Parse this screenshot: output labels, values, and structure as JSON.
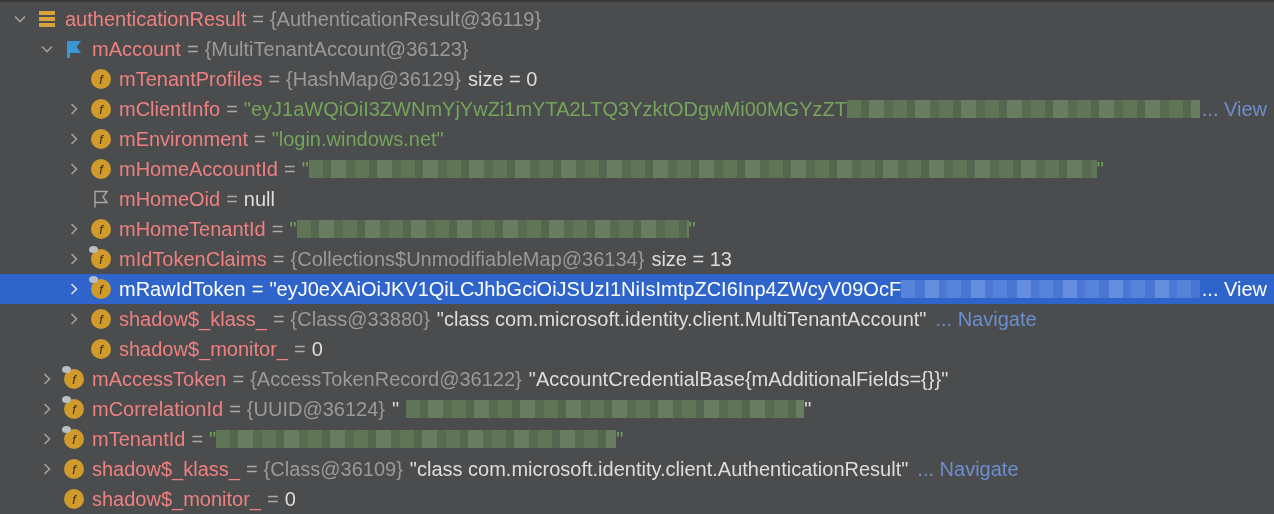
{
  "variables": [
    {
      "name": "authenticationResult",
      "separator": "=",
      "icon": {
        "kind": "object"
      },
      "expanded": true,
      "selected": false,
      "value": [
        {
          "kind": "type",
          "text": "{AuthenticationResult@36119}"
        }
      ],
      "children": [
        {
          "name": "mAccount",
          "separator": "=",
          "icon": {
            "kind": "flag"
          },
          "expanded": true,
          "selected": false,
          "value": [
            {
              "kind": "type",
              "text": "{MultiTenantAccount@36123}"
            }
          ],
          "children": [
            {
              "name": "mTenantProfiles",
              "separator": "=",
              "icon": {
                "kind": "field",
                "letter": "f",
                "overlay": false
              },
              "selected": false,
              "value": [
                {
                  "kind": "type",
                  "text": "{HashMap@36129}"
                },
                {
                  "kind": "plain",
                  "text": "size = 0"
                }
              ]
            },
            {
              "name": "mClientInfo",
              "separator": "=",
              "icon": {
                "kind": "field",
                "letter": "f",
                "overlay": false
              },
              "expanded": false,
              "selected": false,
              "value": [
                {
                  "kind": "string",
                  "text": "\"eyJ1aWQiOiI3ZWNmYjYwZi1mYTA2LTQ3YzktODgwMi00MGYzZT"
                },
                {
                  "kind": "redacted"
                },
                {
                  "kind": "link",
                  "text": "... View"
                }
              ]
            },
            {
              "name": "mEnvironment",
              "separator": "=",
              "icon": {
                "kind": "field",
                "letter": "f",
                "overlay": false
              },
              "expanded": false,
              "selected": false,
              "value": [
                {
                  "kind": "string",
                  "text": "\"login.windows.net\""
                }
              ]
            },
            {
              "name": "mHomeAccountId",
              "separator": "=",
              "icon": {
                "kind": "field",
                "letter": "f",
                "overlay": false
              },
              "expanded": false,
              "selected": false,
              "value": [
                {
                  "kind": "string",
                  "text": "\""
                },
                {
                  "kind": "redacted"
                },
                {
                  "kind": "string",
                  "text": "\""
                }
              ]
            },
            {
              "name": "mHomeOid",
              "separator": "=",
              "icon": {
                "kind": "flag-outline"
              },
              "selected": false,
              "value": [
                {
                  "kind": "plain",
                  "text": "null"
                }
              ]
            },
            {
              "name": "mHomeTenantId",
              "separator": "=",
              "icon": {
                "kind": "field",
                "letter": "f",
                "overlay": false
              },
              "expanded": false,
              "selected": false,
              "value": [
                {
                  "kind": "string",
                  "text": "\""
                },
                {
                  "kind": "redacted"
                },
                {
                  "kind": "string",
                  "text": "\""
                }
              ]
            },
            {
              "name": "mIdTokenClaims",
              "separator": "=",
              "icon": {
                "kind": "field",
                "letter": "f",
                "overlay": true
              },
              "expanded": false,
              "selected": false,
              "value": [
                {
                  "kind": "type",
                  "text": "{Collections$UnmodifiableMap@36134}"
                },
                {
                  "kind": "plain",
                  "text": "size = 13"
                }
              ]
            },
            {
              "name": "mRawIdToken",
              "separator": "=",
              "icon": {
                "kind": "field",
                "letter": "f",
                "overlay": true
              },
              "expanded": false,
              "selected": true,
              "value": [
                {
                  "kind": "string",
                  "text": "\"eyJ0eXAiOiJKV1QiLCJhbGciOiJSUzI1NiIsImtpZCI6Inp4ZWcyV09OcF"
                },
                {
                  "kind": "redacted"
                },
                {
                  "kind": "link",
                  "text": "... View"
                }
              ]
            },
            {
              "name": "shadow$_klass_",
              "separator": "=",
              "icon": {
                "kind": "field",
                "letter": "f",
                "overlay": false
              },
              "expanded": false,
              "selected": false,
              "value": [
                {
                  "kind": "type",
                  "text": "{Class@33880}"
                },
                {
                  "kind": "plain",
                  "text": "\"class com.microsoft.identity.client.MultiTenantAccount\""
                },
                {
                  "kind": "link",
                  "text": "... Navigate"
                }
              ]
            },
            {
              "name": "shadow$_monitor_",
              "separator": "=",
              "icon": {
                "kind": "field",
                "letter": "f",
                "overlay": false
              },
              "selected": false,
              "value": [
                {
                  "kind": "plain",
                  "text": "0"
                }
              ]
            }
          ]
        },
        {
          "name": "mAccessToken",
          "separator": "=",
          "icon": {
            "kind": "field",
            "letter": "f",
            "overlay": true
          },
          "expanded": false,
          "selected": false,
          "value": [
            {
              "kind": "type",
              "text": "{AccessTokenRecord@36122}"
            },
            {
              "kind": "plain",
              "text": "\"AccountCredentialBase{mAdditionalFields={}}\""
            }
          ]
        },
        {
          "name": "mCorrelationId",
          "separator": "=",
          "icon": {
            "kind": "field",
            "letter": "f",
            "overlay": true
          },
          "expanded": false,
          "selected": false,
          "value": [
            {
              "kind": "type",
              "text": "{UUID@36124}"
            },
            {
              "kind": "plain",
              "text": "\""
            },
            {
              "kind": "redacted"
            },
            {
              "kind": "plain",
              "text": "\""
            }
          ]
        },
        {
          "name": "mTenantId",
          "separator": "=",
          "icon": {
            "kind": "field",
            "letter": "f",
            "overlay": true
          },
          "expanded": false,
          "selected": false,
          "value": [
            {
              "kind": "string",
              "text": "\""
            },
            {
              "kind": "redacted"
            },
            {
              "kind": "string",
              "text": "\""
            }
          ]
        },
        {
          "name": "shadow$_klass_",
          "separator": "=",
          "icon": {
            "kind": "field",
            "letter": "f",
            "overlay": false
          },
          "expanded": false,
          "selected": false,
          "value": [
            {
              "kind": "type",
              "text": "{Class@36109}"
            },
            {
              "kind": "plain",
              "text": "\"class com.microsoft.identity.client.AuthenticationResult\""
            },
            {
              "kind": "link",
              "text": "... Navigate"
            }
          ]
        },
        {
          "name": "shadow$_monitor_",
          "separator": "=",
          "icon": {
            "kind": "field",
            "letter": "f",
            "overlay": false
          },
          "selected": false,
          "value": [
            {
              "kind": "plain",
              "text": "0"
            }
          ]
        }
      ]
    }
  ]
}
